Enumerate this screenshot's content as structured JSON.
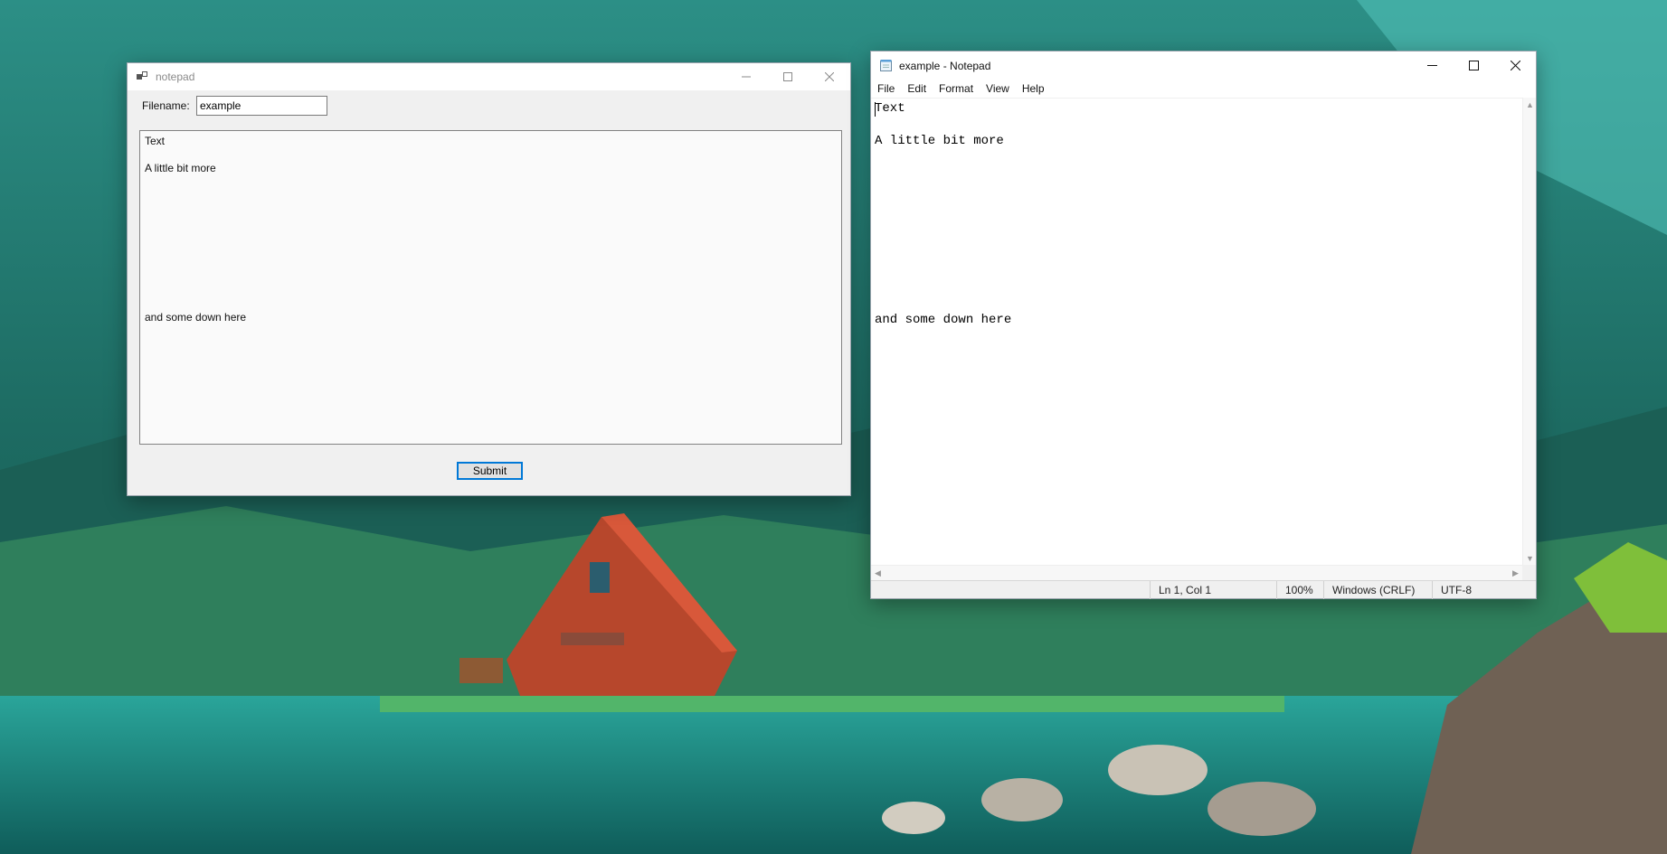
{
  "form_window": {
    "title": "notepad",
    "filename_label": "Filename:",
    "filename_value": "example",
    "text_lines": [
      "Text",
      "A little bit more",
      "and some down here"
    ],
    "submit_label": "Submit"
  },
  "notepad_window": {
    "title": "example - Notepad",
    "menu": [
      "File",
      "Edit",
      "Format",
      "View",
      "Help"
    ],
    "content_lines": [
      "Text",
      "A little bit more",
      "and some down here"
    ],
    "status": {
      "position": "Ln 1, Col 1",
      "zoom": "100%",
      "line_ending": "Windows (CRLF)",
      "encoding": "UTF-8"
    }
  },
  "colors": {
    "accent": "#0078d7"
  }
}
